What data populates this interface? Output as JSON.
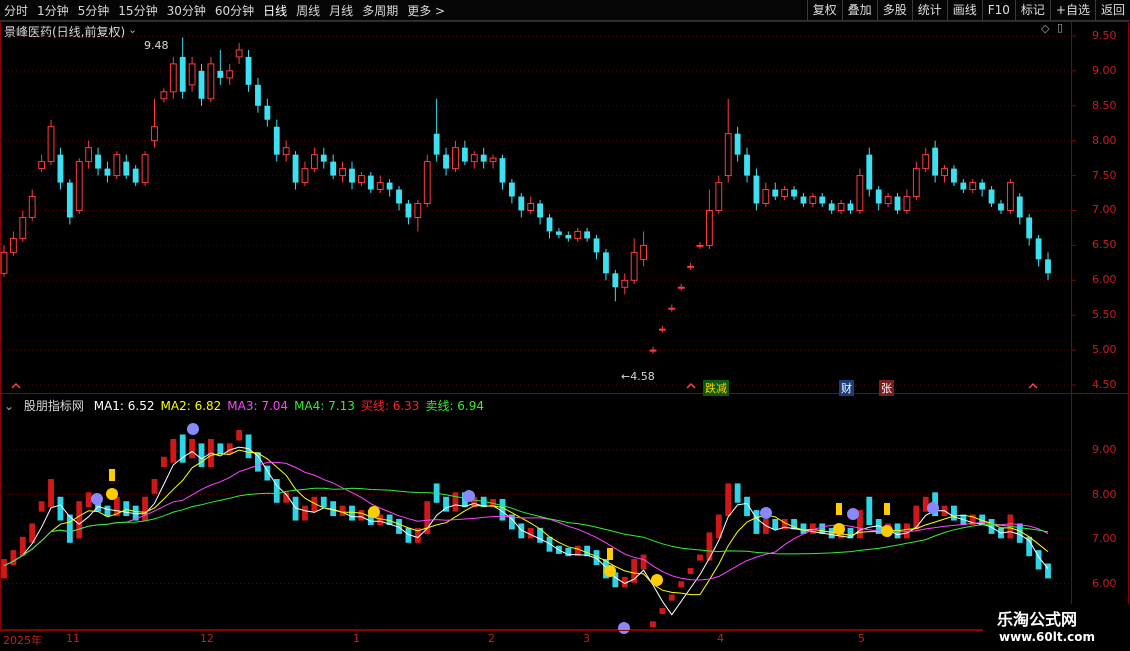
{
  "toolbar": {
    "left_items": [
      "分时",
      "1分钟",
      "5分钟",
      "15分钟",
      "30分钟",
      "60分钟",
      "日线",
      "周线",
      "月线",
      "多周期",
      "更多 >"
    ],
    "right_items": [
      "复权",
      "叠加",
      "多股",
      "统计",
      "画线",
      "F10",
      "标记",
      "+自选",
      "返回"
    ]
  },
  "main_chart": {
    "title": "景峰医药(日线,前复权)",
    "high_label": "9.48",
    "low_label": "←4.58",
    "y_ticks": [
      "9.50",
      "9.00",
      "8.50",
      "8.00",
      "7.50",
      "7.00",
      "6.50",
      "6.00",
      "5.50",
      "5.00",
      "4.50"
    ],
    "event_markers": [
      "跌减",
      "财",
      "张"
    ],
    "colors": {
      "up": "#ff3c3c",
      "down": "#3ce0f0",
      "grid": "#8a0000"
    }
  },
  "indicator": {
    "name": "股朋指标网",
    "legend": [
      {
        "label": "MA1: 6.52",
        "color": "#ffffff"
      },
      {
        "label": "MA2: 6.82",
        "color": "#ffff00"
      },
      {
        "label": "MA3: 7.04",
        "color": "#ff44ff"
      },
      {
        "label": "MA4: 7.13",
        "color": "#33ee33"
      },
      {
        "label": "买线: 6.33",
        "color": "#ff2222"
      },
      {
        "label": "卖线: 6.94",
        "color": "#33ee33"
      }
    ],
    "y_ticks": [
      "9.00",
      "8.00",
      "7.00",
      "6.00"
    ]
  },
  "date_axis": [
    "2025年",
    "11",
    "12",
    "1",
    "2",
    "3",
    "4",
    "5"
  ],
  "watermark": {
    "line1": "乐淘公式网",
    "line2": "www.60lt.com"
  },
  "chart_data": {
    "type": "candlestick",
    "title": "景峰医药(日线,前复权)",
    "ylim": [
      4.4,
      9.7
    ],
    "annotations": {
      "high": 9.48,
      "low": 4.58
    },
    "candles": [
      [
        6.1,
        6.4,
        6.5,
        6.05
      ],
      [
        6.4,
        6.6,
        6.7,
        6.35
      ],
      [
        6.6,
        6.9,
        7.0,
        6.55
      ],
      [
        6.9,
        7.2,
        7.3,
        6.85
      ],
      [
        7.6,
        7.7,
        7.8,
        7.55
      ],
      [
        7.7,
        8.2,
        8.3,
        7.65
      ],
      [
        7.8,
        7.4,
        7.9,
        7.3
      ],
      [
        7.4,
        6.9,
        7.45,
        6.8
      ],
      [
        7.0,
        7.7,
        7.75,
        6.95
      ],
      [
        7.7,
        7.9,
        8.0,
        7.6
      ],
      [
        7.8,
        7.6,
        7.9,
        7.5
      ],
      [
        7.6,
        7.5,
        7.7,
        7.4
      ],
      [
        7.5,
        7.8,
        7.85,
        7.45
      ],
      [
        7.7,
        7.5,
        7.8,
        7.45
      ],
      [
        7.6,
        7.4,
        7.65,
        7.35
      ],
      [
        7.4,
        7.8,
        7.85,
        7.35
      ],
      [
        8.0,
        8.2,
        8.6,
        7.9
      ],
      [
        8.6,
        8.7,
        8.75,
        8.55
      ],
      [
        8.7,
        9.1,
        9.2,
        8.6
      ],
      [
        9.2,
        8.7,
        9.48,
        8.6
      ],
      [
        8.8,
        9.1,
        9.2,
        8.7
      ],
      [
        9.0,
        8.6,
        9.1,
        8.5
      ],
      [
        8.6,
        9.1,
        9.2,
        8.55
      ],
      [
        9.0,
        8.9,
        9.3,
        8.8
      ],
      [
        8.9,
        9.0,
        9.1,
        8.8
      ],
      [
        9.2,
        9.3,
        9.4,
        9.1
      ],
      [
        9.2,
        8.8,
        9.3,
        8.7
      ],
      [
        8.8,
        8.5,
        8.9,
        8.4
      ],
      [
        8.5,
        8.3,
        8.6,
        8.2
      ],
      [
        8.2,
        7.8,
        8.3,
        7.7
      ],
      [
        7.8,
        7.9,
        8.0,
        7.7
      ],
      [
        7.8,
        7.4,
        7.85,
        7.3
      ],
      [
        7.4,
        7.6,
        7.7,
        7.35
      ],
      [
        7.6,
        7.8,
        7.9,
        7.55
      ],
      [
        7.8,
        7.7,
        7.9,
        7.6
      ],
      [
        7.7,
        7.5,
        7.8,
        7.45
      ],
      [
        7.5,
        7.6,
        7.7,
        7.4
      ],
      [
        7.6,
        7.4,
        7.7,
        7.3
      ],
      [
        7.4,
        7.5,
        7.55,
        7.35
      ],
      [
        7.5,
        7.3,
        7.55,
        7.25
      ],
      [
        7.3,
        7.4,
        7.5,
        7.25
      ],
      [
        7.4,
        7.3,
        7.45,
        7.2
      ],
      [
        7.3,
        7.1,
        7.35,
        7.0
      ],
      [
        7.1,
        6.9,
        7.15,
        6.8
      ],
      [
        6.9,
        7.1,
        7.15,
        6.7
      ],
      [
        7.1,
        7.7,
        7.8,
        7.05
      ],
      [
        8.1,
        7.8,
        8.6,
        7.7
      ],
      [
        7.8,
        7.6,
        7.9,
        7.5
      ],
      [
        7.6,
        7.9,
        8.0,
        7.55
      ],
      [
        7.9,
        7.7,
        8.0,
        7.65
      ],
      [
        7.7,
        7.8,
        7.85,
        7.6
      ],
      [
        7.8,
        7.7,
        7.9,
        7.6
      ],
      [
        7.7,
        7.75,
        7.8,
        7.6
      ],
      [
        7.75,
        7.4,
        7.8,
        7.3
      ],
      [
        7.4,
        7.2,
        7.45,
        7.1
      ],
      [
        7.2,
        7.0,
        7.25,
        6.9
      ],
      [
        7.0,
        7.1,
        7.2,
        6.95
      ],
      [
        7.1,
        6.9,
        7.15,
        6.8
      ],
      [
        6.9,
        6.7,
        6.95,
        6.6
      ],
      [
        6.7,
        6.65,
        6.75,
        6.6
      ],
      [
        6.65,
        6.6,
        6.7,
        6.55
      ],
      [
        6.6,
        6.7,
        6.75,
        6.55
      ],
      [
        6.7,
        6.6,
        6.75,
        6.55
      ],
      [
        6.6,
        6.4,
        6.65,
        6.3
      ],
      [
        6.4,
        6.1,
        6.45,
        6.0
      ],
      [
        6.1,
        5.9,
        6.15,
        5.7
      ],
      [
        5.9,
        6.0,
        6.1,
        5.8
      ],
      [
        6.0,
        6.4,
        6.6,
        5.95
      ],
      [
        6.3,
        6.5,
        6.7,
        6.2
      ],
      [
        5.0,
        5.0,
        5.05,
        4.95
      ],
      [
        5.3,
        5.3,
        5.35,
        5.25
      ],
      [
        5.6,
        5.6,
        5.65,
        5.55
      ],
      [
        5.9,
        5.9,
        5.95,
        5.85
      ],
      [
        6.2,
        6.2,
        6.25,
        6.15
      ],
      [
        6.5,
        6.5,
        6.55,
        6.45
      ],
      [
        6.5,
        7.0,
        7.3,
        6.45
      ],
      [
        7.0,
        7.4,
        7.5,
        6.95
      ],
      [
        7.5,
        8.1,
        8.6,
        7.4
      ],
      [
        8.1,
        7.8,
        8.2,
        7.7
      ],
      [
        7.8,
        7.5,
        7.9,
        7.4
      ],
      [
        7.5,
        7.1,
        7.6,
        7.0
      ],
      [
        7.1,
        7.3,
        7.4,
        7.05
      ],
      [
        7.3,
        7.2,
        7.4,
        7.15
      ],
      [
        7.2,
        7.3,
        7.35,
        7.15
      ],
      [
        7.3,
        7.2,
        7.35,
        7.15
      ],
      [
        7.2,
        7.1,
        7.25,
        7.05
      ],
      [
        7.1,
        7.2,
        7.25,
        7.05
      ],
      [
        7.2,
        7.1,
        7.25,
        7.05
      ],
      [
        7.1,
        7.0,
        7.15,
        6.95
      ],
      [
        7.0,
        7.1,
        7.15,
        6.95
      ],
      [
        7.1,
        7.0,
        7.15,
        6.95
      ],
      [
        7.0,
        7.5,
        7.6,
        6.95
      ],
      [
        7.8,
        7.3,
        7.9,
        7.2
      ],
      [
        7.3,
        7.1,
        7.35,
        7.0
      ],
      [
        7.1,
        7.2,
        7.25,
        7.05
      ],
      [
        7.2,
        7.0,
        7.25,
        6.95
      ],
      [
        7.0,
        7.2,
        7.3,
        6.95
      ],
      [
        7.2,
        7.6,
        7.7,
        7.15
      ],
      [
        7.6,
        7.8,
        7.9,
        7.55
      ],
      [
        7.9,
        7.5,
        8.0,
        7.4
      ],
      [
        7.5,
        7.6,
        7.65,
        7.4
      ],
      [
        7.6,
        7.4,
        7.65,
        7.35
      ],
      [
        7.4,
        7.3,
        7.45,
        7.25
      ],
      [
        7.3,
        7.4,
        7.45,
        7.25
      ],
      [
        7.4,
        7.3,
        7.45,
        7.2
      ],
      [
        7.3,
        7.1,
        7.35,
        7.05
      ],
      [
        7.1,
        7.0,
        7.15,
        6.95
      ],
      [
        7.0,
        7.4,
        7.45,
        6.95
      ],
      [
        7.2,
        6.9,
        7.25,
        6.8
      ],
      [
        6.9,
        6.6,
        6.95,
        6.5
      ],
      [
        6.6,
        6.3,
        6.65,
        6.2
      ],
      [
        6.3,
        6.1,
        6.4,
        6.0
      ]
    ]
  }
}
